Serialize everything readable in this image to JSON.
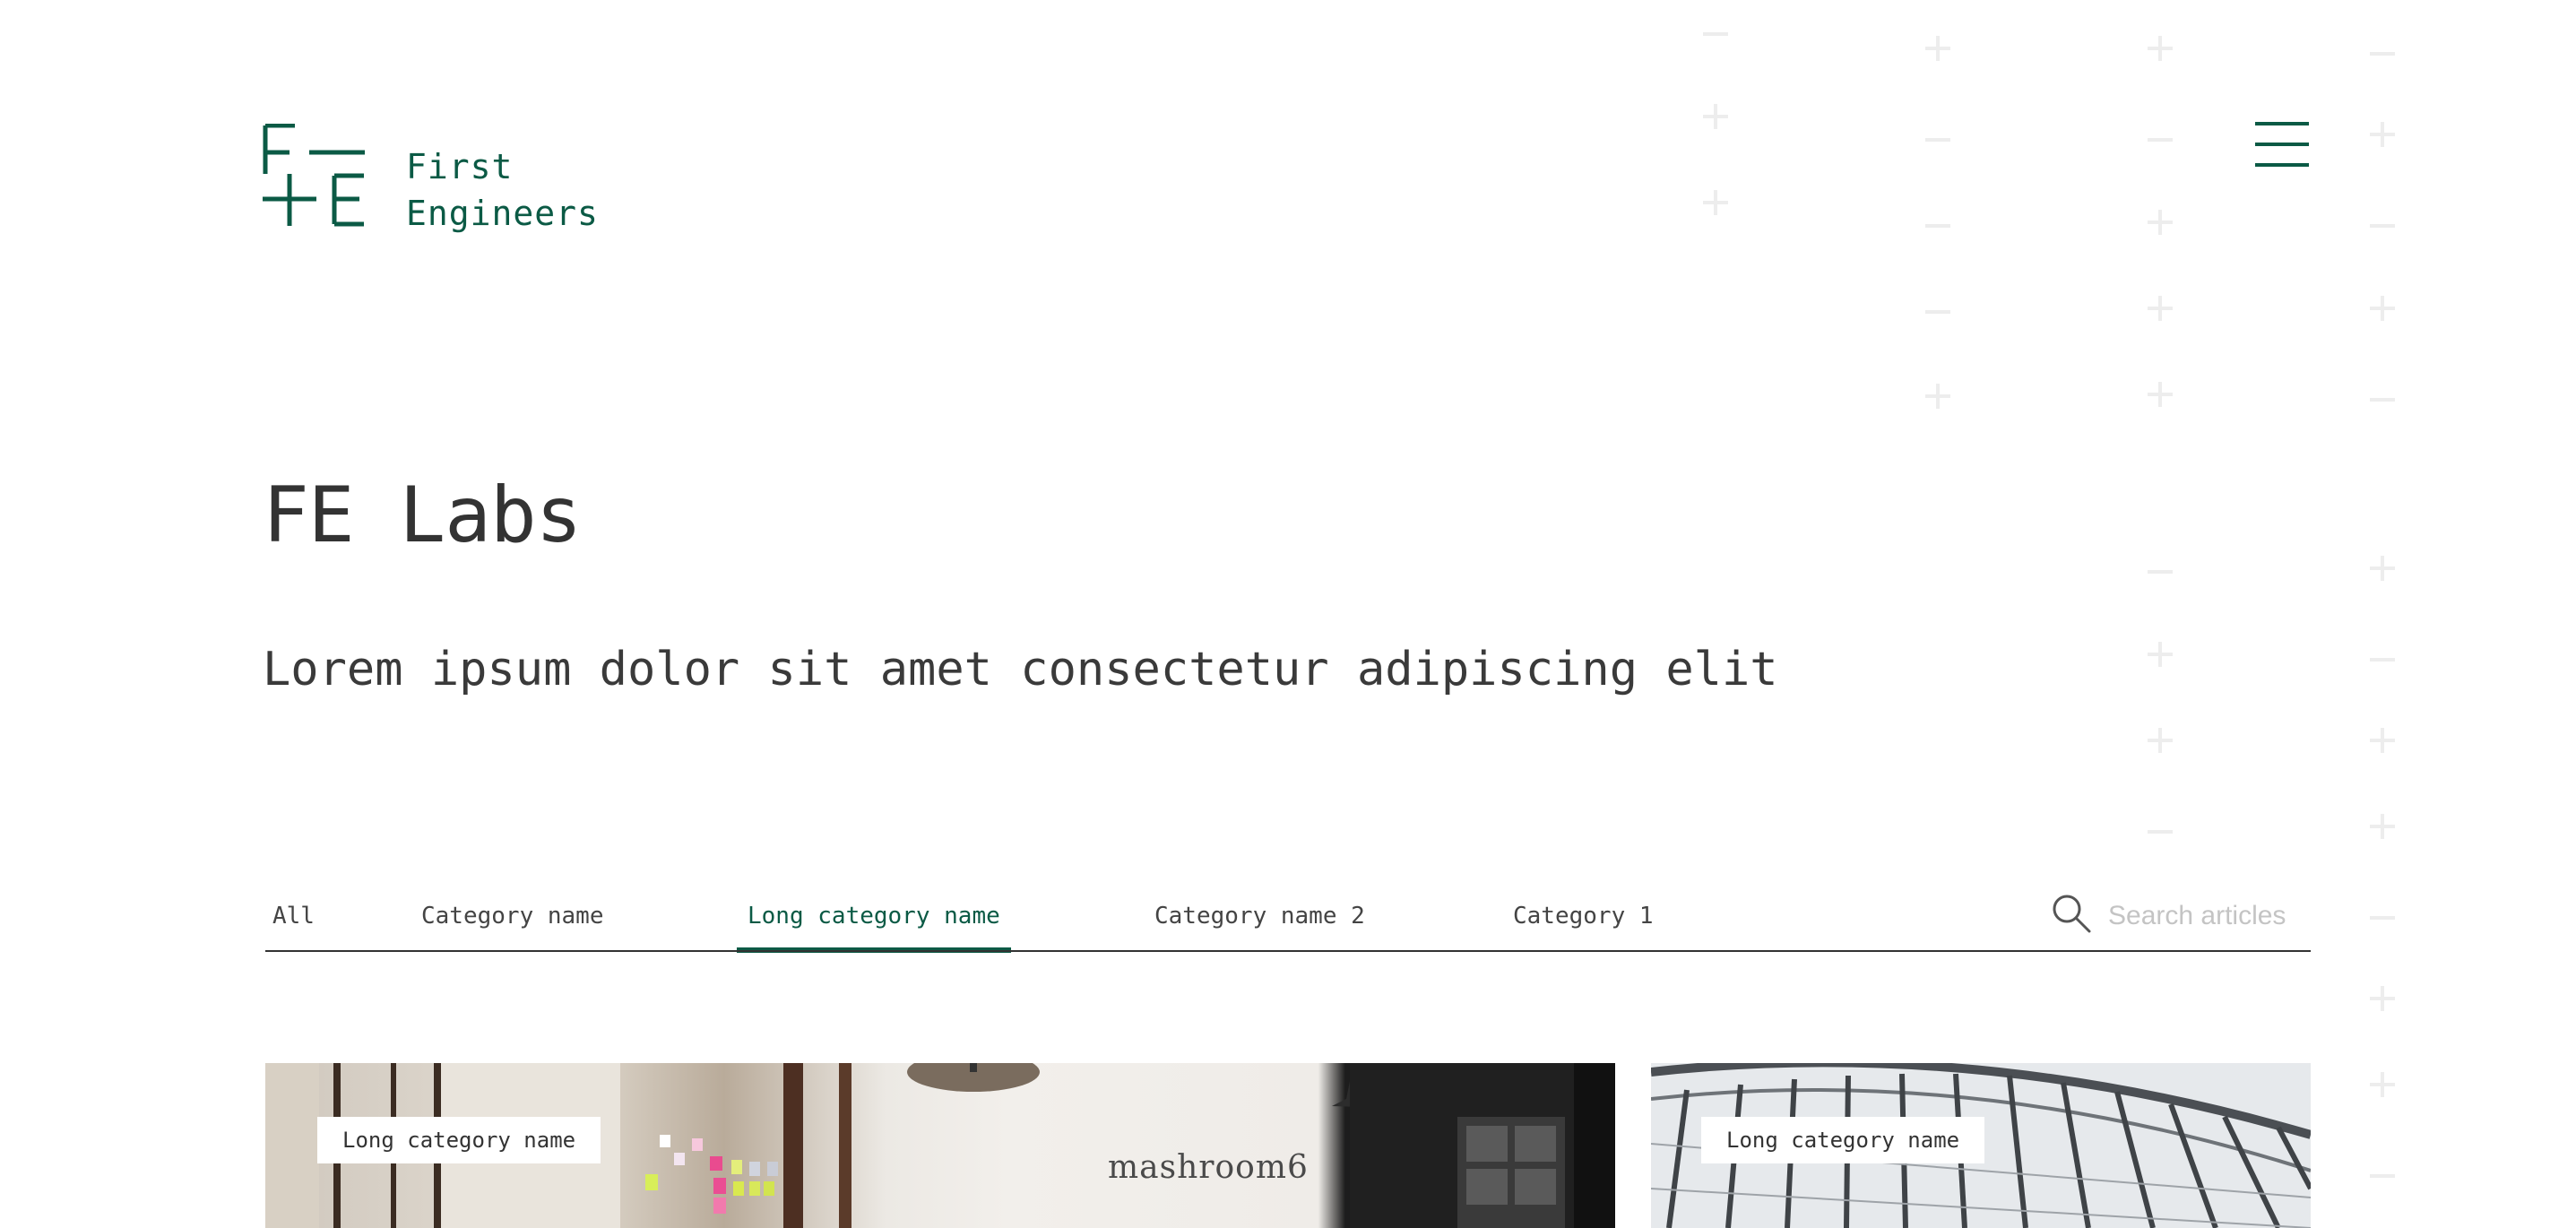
{
  "brand": {
    "logo_line1": "First",
    "logo_line2": "Engineers",
    "color": "#0b5a45"
  },
  "header": {
    "menu_icon": "hamburger-menu-icon"
  },
  "hero": {
    "title": "FE Labs",
    "subtitle": "Lorem ipsum dolor sit amet consectetur adipiscing elit"
  },
  "filters": {
    "tabs": [
      {
        "label": "All",
        "active": false
      },
      {
        "label": "Category name",
        "active": false
      },
      {
        "label": "Long category name",
        "active": true
      },
      {
        "label": "Category name 2",
        "active": false
      },
      {
        "label": "Category 1",
        "active": false
      }
    ],
    "search": {
      "placeholder": "Search articles",
      "value": "",
      "icon": "search-icon"
    }
  },
  "articles": [
    {
      "category": "Long category name",
      "sign_text": "mashroom6"
    },
    {
      "category": "Long category name"
    }
  ],
  "colors": {
    "accent": "#0b5a45",
    "text": "#333333",
    "decoration": "#ededed"
  }
}
